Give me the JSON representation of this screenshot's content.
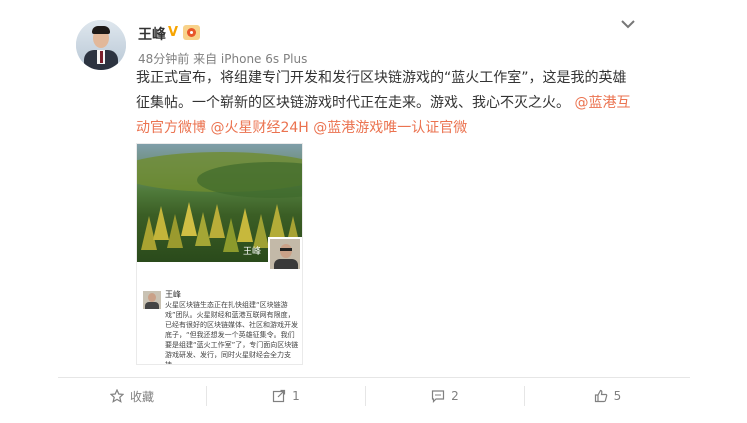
{
  "post": {
    "username": "王峰",
    "verified_badge": "V",
    "time": "48分钟前",
    "source": "来自 iPhone 6s Plus",
    "content_text": "我正式宣布，将组建专门开发和发行区块链游戏的“蓝火工作室”，这是我的英雄征集帖。一个崭新的区块链游戏时代正在走来。游戏、我心不灭之火。",
    "mentions": [
      "@蓝港互动官方微博",
      "@火星财经24H",
      "@蓝港游戏唯一认证官微"
    ]
  },
  "media": {
    "image_caption_name": "王峰",
    "embedded_post_name": "王峰",
    "embedded_post_text": "火星区块链生态正在扎快组建“区块链游戏”团队。火星财经和蓝港互联网有限度，已经有很好的区块链媒体、社区和游戏开发底子，“但我还想发一个英雄征集令。我们要是组建“蓝火工作室”了，专门面向区块链游戏研发、发行，同时火星财经会全力支持。"
  },
  "actions": {
    "favorite_label": "收藏",
    "repost_count": "1",
    "comment_count": "2",
    "like_count": "5"
  },
  "icons": {
    "expand": "chevron-down-icon",
    "favorite": "star-icon",
    "repost": "repost-icon",
    "comment": "comment-icon",
    "like": "thumbs-up-icon"
  },
  "colors": {
    "link": "#eb7350",
    "meta": "#808080",
    "verified": "#f7a400"
  }
}
